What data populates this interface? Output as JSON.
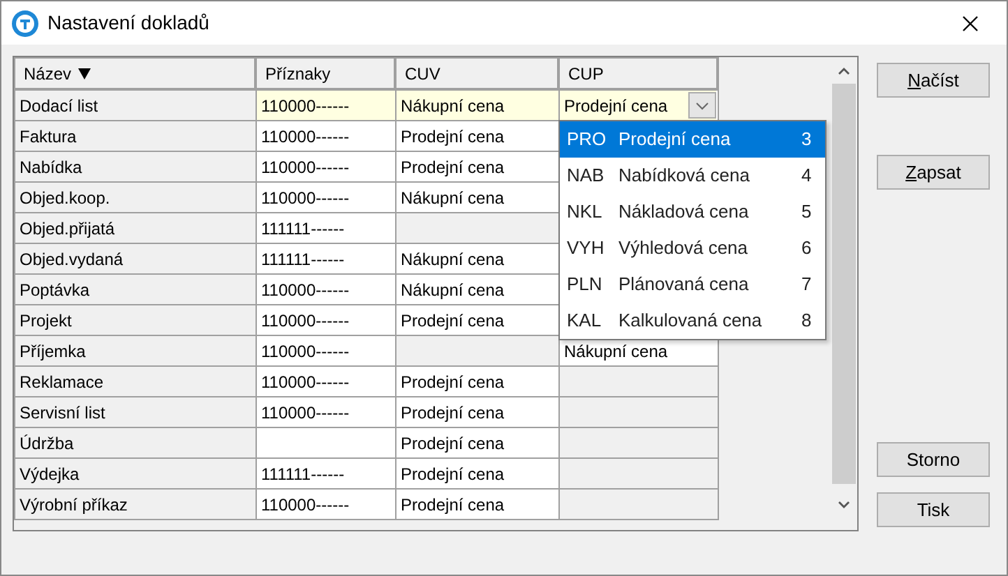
{
  "window": {
    "title": "Nastavení dokladů"
  },
  "table": {
    "columns": [
      {
        "label": "Název",
        "sorted": true
      },
      {
        "label": "Příznaky",
        "sorted": false
      },
      {
        "label": "CUV",
        "sorted": false
      },
      {
        "label": "CUP",
        "sorted": false
      }
    ],
    "rows": [
      {
        "name": "Dodací list",
        "flags": "110000------",
        "cuv": "Nákupní cena",
        "cup": "Prodejní cena",
        "selected": true
      },
      {
        "name": "Faktura",
        "flags": "110000------",
        "cuv": "Prodejní cena",
        "selected": false
      },
      {
        "name": "Nabídka",
        "flags": "110000------",
        "cuv": "Prodejní cena",
        "selected": false
      },
      {
        "name": "Objed.koop.",
        "flags": "110000------",
        "cuv": "Nákupní cena",
        "selected": false
      },
      {
        "name": "Objed.přijatá",
        "flags": "111111------",
        "selected": false
      },
      {
        "name": "Objed.vydaná",
        "flags": "111111------",
        "cuv": "Nákupní cena",
        "selected": false
      },
      {
        "name": "Poptávka",
        "flags": "110000------",
        "cuv": "Nákupní cena",
        "selected": false
      },
      {
        "name": "Projekt",
        "flags": "110000------",
        "cuv": "Prodejní cena",
        "selected": false
      },
      {
        "name": "Příjemka",
        "flags": "110000------",
        "cup": "Nákupní cena",
        "selected": false
      },
      {
        "name": "Reklamace",
        "flags": "110000------",
        "cuv": "Prodejní cena",
        "selected": false
      },
      {
        "name": "Servisní list",
        "flags": "110000------",
        "cuv": "Prodejní cena",
        "selected": false
      },
      {
        "name": "Údržba",
        "cuv": "Prodejní cena",
        "selected": false
      },
      {
        "name": "Výdejka",
        "flags": "111111------",
        "cuv": "Prodejní cena",
        "selected": false
      },
      {
        "name": "Výrobní příkaz",
        "flags": "110000------",
        "cuv": "Prodejní cena",
        "selected": false
      }
    ]
  },
  "dropdown": {
    "open": true,
    "options": [
      {
        "code": "PRO",
        "label": "Prodejní cena",
        "number": "3",
        "selected": true
      },
      {
        "code": "NAB",
        "label": "Nabídková cena",
        "number": "4",
        "selected": false
      },
      {
        "code": "NKL",
        "label": "Nákladová cena",
        "number": "5",
        "selected": false
      },
      {
        "code": "VYH",
        "label": "Výhledová cena",
        "number": "6",
        "selected": false
      },
      {
        "code": "PLN",
        "label": "Plánovaná cena",
        "number": "7",
        "selected": false
      },
      {
        "code": "KAL",
        "label": "Kalkulovaná cena",
        "number": "8",
        "selected": false
      }
    ]
  },
  "buttons": [
    {
      "label": "Načíst",
      "underline_first": true,
      "kind": "top"
    },
    {
      "label": "Zapsat",
      "underline_first": true,
      "kind": "top"
    },
    {
      "label": "Storno",
      "underline_first": false,
      "kind": "bottom"
    },
    {
      "label": "Tisk",
      "underline_first": false,
      "kind": "bottom"
    }
  ]
}
